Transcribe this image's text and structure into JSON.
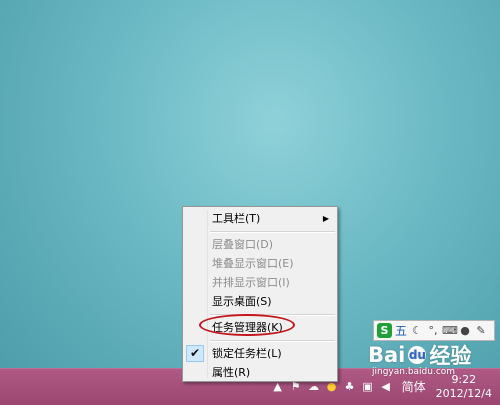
{
  "context_menu": {
    "items": [
      {
        "label": "工具栏(T)",
        "disabled": false,
        "submenu": true
      },
      {
        "label": "层叠窗口(D)",
        "disabled": true
      },
      {
        "label": "堆叠显示窗口(E)",
        "disabled": true
      },
      {
        "label": "并排显示窗口(I)",
        "disabled": true
      },
      {
        "label": "显示桌面(S)",
        "disabled": false
      },
      {
        "label": "任务管理器(K)",
        "disabled": false,
        "highlighted": true
      },
      {
        "label": "锁定任务栏(L)",
        "disabled": false,
        "checked": true
      },
      {
        "label": "属性(R)",
        "disabled": false
      }
    ],
    "check_mark": "✔",
    "submenu_arrow": "▶"
  },
  "ime_toolbar": {
    "logo": "S",
    "mode": "五"
  },
  "tray": {
    "ime_label": "简体",
    "time": "9:22",
    "date": "2012/12/4"
  },
  "watermark": {
    "brand_left": "Bai",
    "brand_right": "经验",
    "url": "jingyan.baidu.com"
  },
  "colors": {
    "taskbar": "#a24f7a",
    "desktop": "#6ab9c4",
    "highlight_ring": "#c4161c"
  }
}
